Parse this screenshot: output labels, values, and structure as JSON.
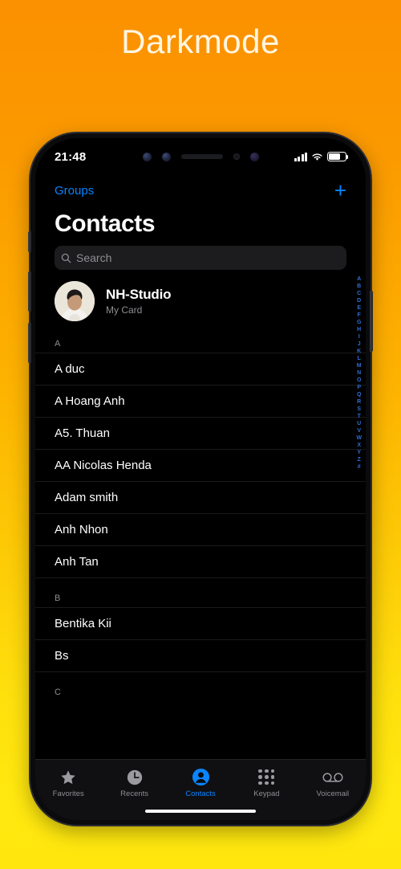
{
  "poster": {
    "title": "Darkmode"
  },
  "colors": {
    "bg_top": "#fb9000",
    "bg_bottom": "#ffe70e",
    "accent_blue": "#0a84ff",
    "index_blue": "#2f6fd6",
    "title_cream": "#fff6e2",
    "secondary_text": "#8e8e93",
    "search_field": "#1c1c1e",
    "tabbar_bg": "#101012"
  },
  "status_bar": {
    "time": "21:48",
    "signal_icon": "cellular-bars-icon",
    "wifi_icon": "wifi-icon",
    "battery_icon": "battery-icon",
    "battery_level": 72
  },
  "nav_bar": {
    "groups_label": "Groups",
    "add_label": "+"
  },
  "header": {
    "title": "Contacts"
  },
  "search": {
    "placeholder": "Search",
    "value": "",
    "icon": "search-icon"
  },
  "my_card": {
    "name": "NH-Studio",
    "subtitle": "My Card"
  },
  "contacts": [
    {
      "letter": "A",
      "names": [
        "A duc",
        "A Hoang Anh",
        "A5. Thuan",
        "AA Nicolas Henda",
        "Adam smith",
        "Anh Nhon",
        "Anh Tan"
      ]
    },
    {
      "letter": "B",
      "names": [
        "Bentika Kii",
        "Bs"
      ]
    },
    {
      "letter": "C",
      "names": []
    }
  ],
  "alphabet_index": [
    "A",
    "B",
    "C",
    "D",
    "E",
    "F",
    "G",
    "H",
    "I",
    "J",
    "K",
    "L",
    "M",
    "N",
    "O",
    "P",
    "Q",
    "R",
    "S",
    "T",
    "U",
    "V",
    "W",
    "X",
    "Y",
    "Z",
    "#"
  ],
  "tab_bar": {
    "tabs": [
      {
        "label": "Favorites",
        "icon": "star-icon",
        "active": false
      },
      {
        "label": "Recents",
        "icon": "clock-icon",
        "active": false
      },
      {
        "label": "Contacts",
        "icon": "person-circle-icon",
        "active": true
      },
      {
        "label": "Keypad",
        "icon": "keypad-grid-icon",
        "active": false
      },
      {
        "label": "Voicemail",
        "icon": "voicemail-icon",
        "active": false
      }
    ]
  }
}
